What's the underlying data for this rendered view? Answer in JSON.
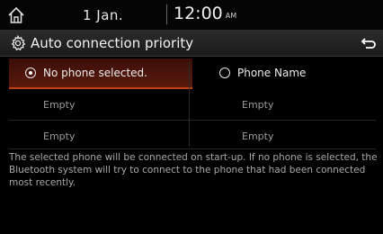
{
  "status_bar": {
    "date": "1  Jan.",
    "time": "12:00",
    "ampm": "AM"
  },
  "header": {
    "title": "Auto connection priority"
  },
  "options": {
    "left": {
      "selected_label": "No phone selected.",
      "slot2": "Empty",
      "slot3": "Empty"
    },
    "right": {
      "label": "Phone Name",
      "slot2": "Empty",
      "slot3": "Empty"
    }
  },
  "description": "The selected phone will be connected on start-up. If no phone is selected, the Bluetooth system will try to connect to the phone that had been connected most recently.",
  "colors": {
    "accent": "#c0400f",
    "selected_bg": "#4a150a",
    "background": "#000000"
  }
}
